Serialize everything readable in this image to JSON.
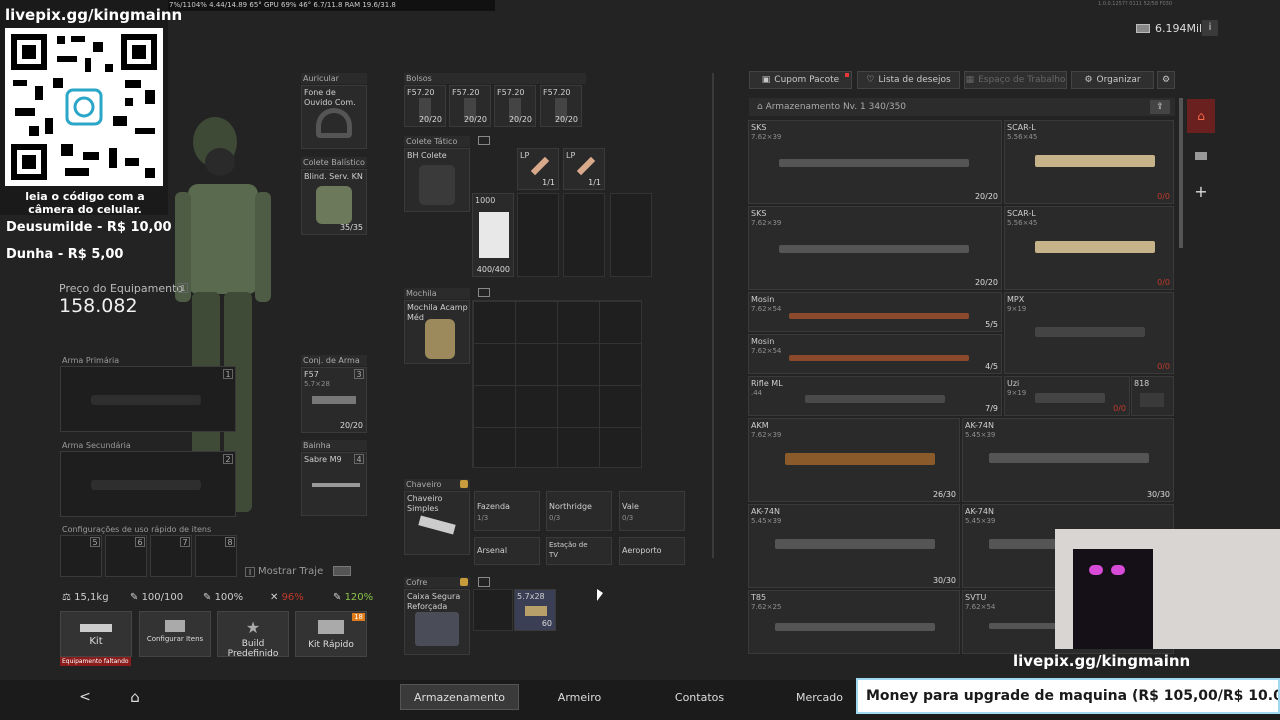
{
  "perf_overlay": {
    "text": "7%/1104%   4.44/14.89   65°  GPU 69%  46°  6.7/11.8  RAM 19.6/31.8"
  },
  "build_info": "1.0.0.1257? 0111 52/58 F030",
  "currency": {
    "value": "6.194Mil",
    "icon": "money-icon"
  },
  "stream": {
    "pix_url": "livepix.gg/kingmainn",
    "qr_caption": "leia o código com a câmera do celular.",
    "donation1": "Deusumilde - R$ 10,00",
    "donation2": "Dunha - R$ 5,00",
    "pix_url_bottom": "livepix.gg/kingmainn",
    "goal": "Money para upgrade de maquina (R$ 105,00/R$ 10.00"
  },
  "equipment": {
    "price_label": "Preço do Equipamento",
    "price_badge": "1",
    "price_value": "158.082",
    "auricular": {
      "label": "Auricular",
      "item": "Fone de Ouvido Com."
    },
    "colete_balistico": {
      "label": "Colete Balístico",
      "item": "Blind. Serv. KN",
      "count": "35/35"
    },
    "arma_primaria": {
      "label": "Arma Primária",
      "key": "1"
    },
    "arma_secundaria": {
      "label": "Arma Secundária",
      "key": "2"
    },
    "conj_arma": {
      "label": "Conj. de Arma",
      "key": "3",
      "item": "F57",
      "cal": "5.7×28",
      "count": "20/20"
    },
    "bainha": {
      "label": "Bainha",
      "key": "4",
      "item": "Sabre M9"
    },
    "quick_use": {
      "label": "Configurações de uso rápido de itens",
      "keys": [
        "5",
        "6",
        "7",
        "8"
      ]
    },
    "mostrar_traje": {
      "key": "I",
      "label": "Mostrar Traje"
    }
  },
  "stats": {
    "weight": "15,1kg",
    "stat2": "100/100",
    "stat3": "100%",
    "stat4": "96%",
    "stat5": "120%"
  },
  "actions": [
    {
      "label": "Kit",
      "sub": "Equipamento faltando"
    },
    {
      "label": "Configurar Itens"
    },
    {
      "label": "Build Predefinido"
    },
    {
      "label": "Kit Rápido",
      "badge": "18"
    }
  ],
  "bolsos": {
    "label": "Bolsos",
    "items": [
      {
        "name": "F57.20",
        "count": "20/20"
      },
      {
        "name": "F57.20",
        "count": "20/20"
      },
      {
        "name": "F57.20",
        "count": "20/20"
      },
      {
        "name": "F57.20",
        "count": "20/20"
      }
    ]
  },
  "colete_tatico": {
    "label": "Colete Tático",
    "item": "BH Colete",
    "lp1": {
      "name": "LP",
      "count": "1/1"
    },
    "lp2": {
      "name": "LP",
      "count": "1/1"
    },
    "money": {
      "name": "1000",
      "count": "400/400"
    }
  },
  "mochila": {
    "label": "Mochila",
    "item": "Mochila Acamp Méd"
  },
  "chaveiro": {
    "label": "Chaveiro",
    "item": "Chaveiro Simples",
    "slots": [
      {
        "name": "Fazenda",
        "count": "1/3"
      },
      {
        "name": "Northridge",
        "count": "0/3"
      },
      {
        "name": "Vale",
        "count": "0/3"
      },
      {
        "name": "Arsenal",
        "count": "0/3"
      },
      {
        "name": "Estação de TV",
        "count": "0/3"
      },
      {
        "name": "Aeroporto",
        "count": "0/3"
      }
    ]
  },
  "cofre": {
    "label": "Cofre",
    "item": "Caixa Segura Reforçada",
    "ammo": {
      "name": "5.7x28",
      "count": "60"
    }
  },
  "storage_toolbar": {
    "cupom": "Cupom Pacote",
    "desejos": "Lista de desejos",
    "espaco": "Espaço de Trabalho",
    "organizar": "Organizar"
  },
  "storage": {
    "title": "Armazenamento Nv. 1",
    "capacity": "340/350",
    "items": [
      {
        "name": "SKS",
        "cal": "7.62×39",
        "count": "20/20"
      },
      {
        "name": "SCAR-L",
        "cal": "5.56×45",
        "count": "0/0"
      },
      {
        "name": "SKS",
        "cal": "7.62×39",
        "count": "20/20"
      },
      {
        "name": "SCAR-L",
        "cal": "5.56×45",
        "count": "0/0"
      },
      {
        "name": "Mosin",
        "cal": "7.62×54",
        "count": "5/5"
      },
      {
        "name": "MPX",
        "cal": "9×19",
        "count": "0/0"
      },
      {
        "name": "Mosin",
        "cal": "7.62×54",
        "count": "4/5"
      },
      {
        "name": "Rifle ML",
        "cal": ".44",
        "count": "7/9"
      },
      {
        "name": "Uzi",
        "cal": "9×19",
        "count": "0/0"
      },
      {
        "name": "818",
        "cal": "",
        "count": ""
      },
      {
        "name": "AKM",
        "cal": "7.62×39",
        "count": "26/30"
      },
      {
        "name": "AK-74N",
        "cal": "5.45×39",
        "count": "30/30"
      },
      {
        "name": "AK-74N",
        "cal": "5.45×39",
        "count": "30/30"
      },
      {
        "name": "AK-74N",
        "cal": "5.45×39",
        "count": ""
      },
      {
        "name": "T85",
        "cal": "7.62×25",
        "count": ""
      },
      {
        "name": "SVTU",
        "cal": "7.62×54",
        "count": ""
      }
    ]
  },
  "nav": {
    "tabs": [
      "Armazenamento",
      "Armeiro",
      "Contatos",
      "Mercado"
    ],
    "active": "Armazenamento"
  }
}
